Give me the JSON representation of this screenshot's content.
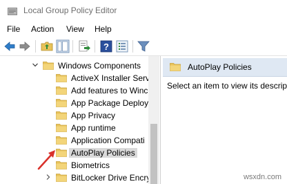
{
  "window": {
    "title": "Local Group Policy Editor"
  },
  "menu": {
    "items": [
      {
        "label": "File"
      },
      {
        "label": "Action"
      },
      {
        "label": "View"
      },
      {
        "label": "Help"
      }
    ]
  },
  "toolbar": {
    "buttons": [
      {
        "icon": "back-arrow-icon"
      },
      {
        "icon": "forward-arrow-icon"
      },
      {
        "icon": "up-folder-icon"
      },
      {
        "icon": "show-hide-tree-icon"
      },
      {
        "icon": "export-list-icon"
      },
      {
        "icon": "help-icon"
      },
      {
        "icon": "properties-icon"
      },
      {
        "icon": "filter-icon"
      }
    ]
  },
  "tree": {
    "items": [
      {
        "label": "Windows Components",
        "expander": "expanded"
      },
      {
        "label": "ActiveX Installer Serv"
      },
      {
        "label": "Add features to Winc"
      },
      {
        "label": "App Package Deploy"
      },
      {
        "label": "App Privacy"
      },
      {
        "label": "App runtime"
      },
      {
        "label": "Application Compati"
      },
      {
        "label": "AutoPlay Policies",
        "selected": true
      },
      {
        "label": "Biometrics"
      },
      {
        "label": "BitLocker Drive Encry",
        "expander": "collapsed"
      }
    ]
  },
  "detail": {
    "header_title": "AutoPlay Policies",
    "message": "Select an item to view its descript"
  },
  "watermark": "wsxdn.com",
  "colors": {
    "folder": "#e8c35a",
    "folder_dark": "#c9a13a",
    "header_bg": "#dfe8f3",
    "selection": "#d9d9d9",
    "arrow": "#d9312b"
  }
}
